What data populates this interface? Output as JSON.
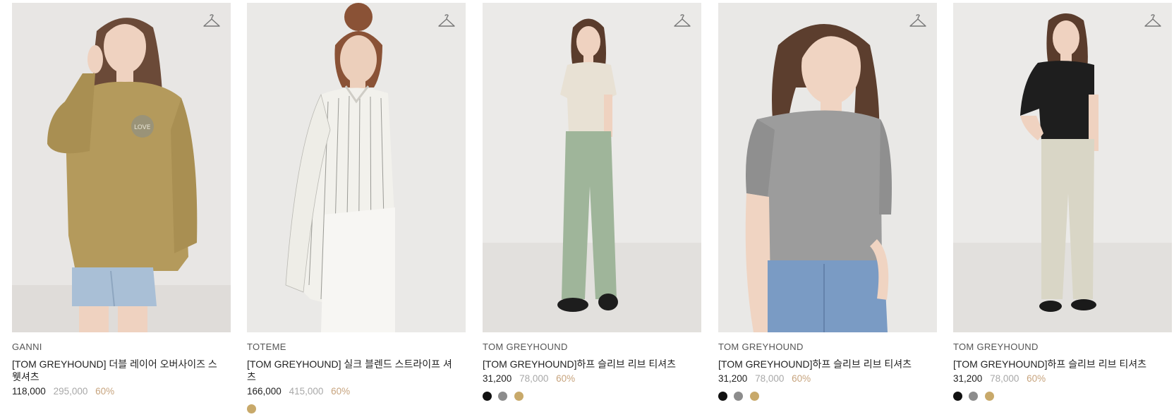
{
  "products": [
    {
      "brand": "GANNI",
      "name": "[TOM GREYHOUND] 더블 레이어 오버사이즈 스웻셔츠",
      "sale_price": "118,000",
      "original_price": "295,000",
      "discount": "60%",
      "image_desc": "model in olive oversized sweatshirt and denim shorts",
      "swatches": [
        "#c8a96a"
      ],
      "colors": {
        "bg": "#e8e6e4",
        "top": "#b49a5c",
        "bottom": "#a9bfd6",
        "hair": "#6b4a38",
        "skin": "#efd2c0"
      }
    },
    {
      "brand": "TOTEME",
      "name": "[TOM GREYHOUND] 실크 블렌드 스트라이프 셔츠",
      "sale_price": "166,000",
      "original_price": "415,000",
      "discount": "60%",
      "image_desc": "model in white striped shirt and white pants",
      "swatches": [
        "#c8a96a"
      ],
      "colors": {
        "bg": "#eae9e7",
        "top": "#f2f1ec",
        "bottom": "#f7f6f3",
        "hair": "#8a5236",
        "skin": "#eccfbb"
      }
    },
    {
      "brand": "TOM GREYHOUND",
      "name": "[TOM GREYHOUND]하프 슬리브 리브 티셔츠",
      "sale_price": "31,200",
      "original_price": "78,000",
      "discount": "60%",
      "image_desc": "model in beige ribbed tee and green trousers",
      "swatches": [
        "#111111",
        "#8c8c8c",
        "#c8a96a"
      ],
      "colors": {
        "bg": "#ebeae8",
        "top": "#e8e1d4",
        "bottom": "#9fb59a",
        "hair": "#5a3c2c",
        "skin": "#efd2c0"
      }
    },
    {
      "brand": "TOM GREYHOUND",
      "name": "[TOM GREYHOUND]하프 슬리브 리브 티셔츠",
      "sale_price": "31,200",
      "original_price": "78,000",
      "discount": "60%",
      "image_desc": "model in grey ribbed tee and blue jeans",
      "swatches": [
        "#111111",
        "#8c8c8c",
        "#c8a96a"
      ],
      "colors": {
        "bg": "#e9e8e6",
        "top": "#9c9c9c",
        "bottom": "#7a9bc4",
        "hair": "#5c3e2e",
        "skin": "#f0d4c2"
      }
    },
    {
      "brand": "TOM GREYHOUND",
      "name": "[TOM GREYHOUND]하프 슬리브 리브 티셔츠",
      "sale_price": "31,200",
      "original_price": "78,000",
      "discount": "60%",
      "image_desc": "model in black ribbed tee and light jeans",
      "swatches": [
        "#111111",
        "#8c8c8c",
        "#c8a96a"
      ],
      "colors": {
        "bg": "#ebeae8",
        "top": "#1e1e1e",
        "bottom": "#d9d6c6",
        "hair": "#5a3c2c",
        "skin": "#efd2c0"
      }
    }
  ],
  "icons": {
    "wishlist": "hanger-icon"
  }
}
